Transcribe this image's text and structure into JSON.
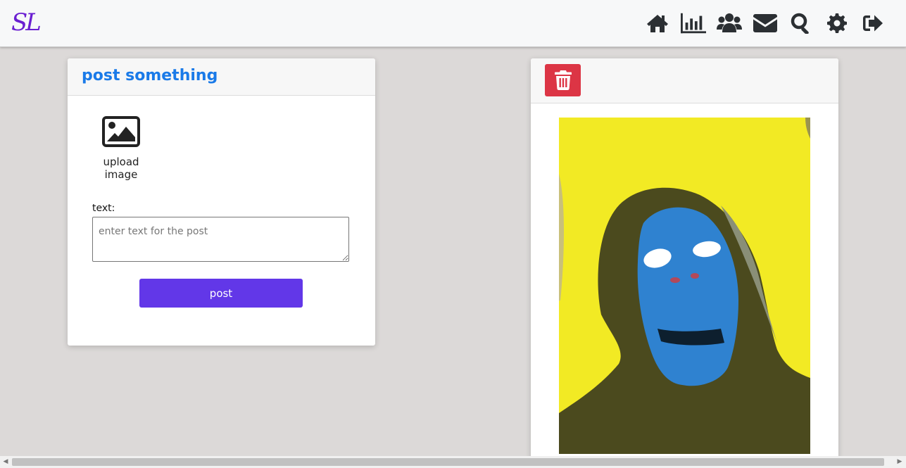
{
  "nav": {
    "logo": "SL",
    "icons": [
      "home-icon",
      "stats-icon",
      "users-icon",
      "mail-icon",
      "search-icon",
      "gear-icon",
      "logout-icon"
    ]
  },
  "post_form": {
    "title": "post something",
    "upload_label": "upload image",
    "text_label": "text:",
    "text_placeholder": "enter text for the post",
    "text_value": "",
    "submit_label": "post"
  },
  "post_card": {
    "delete_icon": "trash-icon",
    "image_desc_colors": {
      "background": "#f2ea24",
      "face": "#2f82d0",
      "hood": "#4b4a1e"
    }
  },
  "colors": {
    "accent_title": "#1a7ae8",
    "button_primary": "#6237e8",
    "button_danger": "#dc3545",
    "logo": "#6a1fd1",
    "page_bg": "#dcd9d8"
  }
}
